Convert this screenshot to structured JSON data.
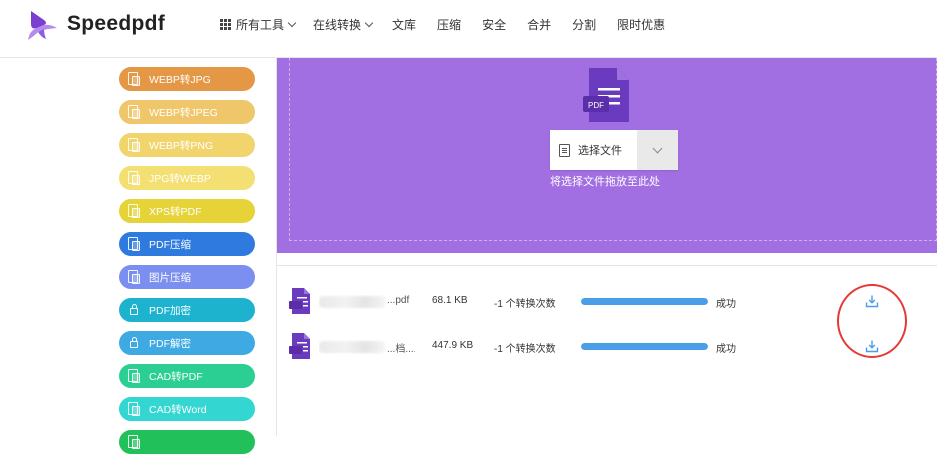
{
  "brand": {
    "name": "Speedpdf"
  },
  "nav": {
    "all_tools": "所有工具",
    "online_convert": "在线转换",
    "library": "文库",
    "compress": "压缩",
    "security": "安全",
    "merge": "合并",
    "split": "分割",
    "limited_offer": "限时优惠"
  },
  "sidebar": {
    "items": [
      {
        "label": "WEBP转JPG",
        "color": "#e49744"
      },
      {
        "label": "WEBP转JPEG",
        "color": "#f0c66a"
      },
      {
        "label": "WEBP转PNG",
        "color": "#f2d46c"
      },
      {
        "label": "JPG转WEBP",
        "color": "#f3df72"
      },
      {
        "label": "XPS转PDF",
        "color": "#e5d337"
      },
      {
        "label": "PDF压缩",
        "color": "#2f7adf"
      },
      {
        "label": "图片压缩",
        "color": "#7b8ff0"
      },
      {
        "label": "PDF加密",
        "color": "#1db3cf"
      },
      {
        "label": "PDF解密",
        "color": "#3fa9e3"
      },
      {
        "label": "CAD转PDF",
        "color": "#2ccf93"
      },
      {
        "label": "CAD转Word",
        "color": "#33d6d0"
      },
      {
        "label": "",
        "color": "#22c05a"
      }
    ]
  },
  "upload": {
    "icon_label": "PDF",
    "select_button": "选择文件",
    "drop_hint": "将选择文件拖放至此处",
    "background": "#a26fe3"
  },
  "files": [
    {
      "name_visible": "...pdf",
      "size": "68.1 KB",
      "conversions": "-1 个转换次数",
      "progress": 1.0,
      "status": "成功"
    },
    {
      "name_visible": "...档....",
      "size": "447.9 KB",
      "conversions": "-1 个转换次数",
      "progress": 1.0,
      "status": "成功"
    }
  ],
  "colors": {
    "accent": "#a26fe3",
    "progress": "#4a9ee8",
    "highlight_circle": "#e53935"
  }
}
